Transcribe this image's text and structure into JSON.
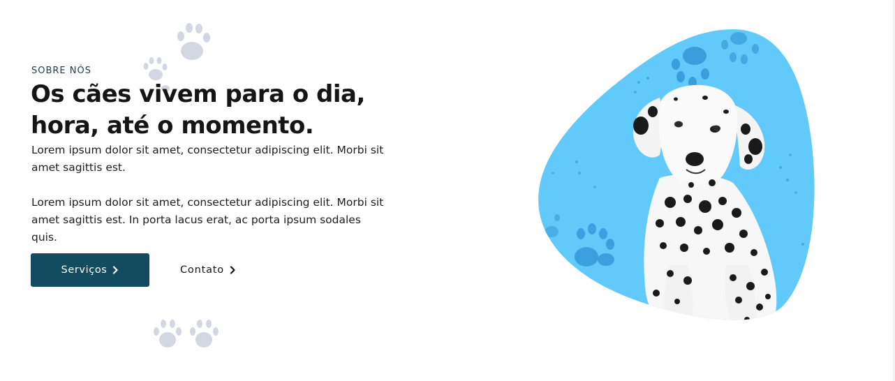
{
  "about": {
    "eyebrow": "SOBRE NÓS",
    "headline": "Os cães vivem para o dia, hora, até o momento.",
    "paragraph_1": "Lorem ipsum dolor sit amet, consectetur adipiscing elit. Morbi sit amet sagittis est.",
    "paragraph_2": "Lorem ipsum dolor sit amet, consectetur adipiscing elit. Morbi sit amet sagittis est. In porta lacus erat, ac porta ipsum sodales quis."
  },
  "actions": {
    "primary_label": "Serviços",
    "primary_icon": "chevron-right-icon",
    "secondary_label": "Contato",
    "secondary_icon": "chevron-right-icon"
  },
  "image": {
    "subject": "dalmatian-puppy",
    "decoration": "paw-prints"
  },
  "colors": {
    "primary_button": "#134c60",
    "blob": "#62c9fb",
    "paw_dark": "#2c8fd0",
    "paw_faint": "#cfd3df",
    "heading": "#151515"
  }
}
